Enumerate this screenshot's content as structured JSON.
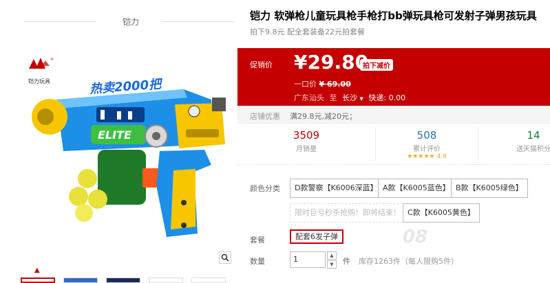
{
  "brand": {
    "name": "铠力",
    "logo_text": "铠力玩具"
  },
  "product": {
    "title": "铠力 软弹枪儿童玩具枪手枪打bb弹玩具枪可发射子弹男孩玩具",
    "subtitle": "拍下9.8元 配全套装备22元拍套餐",
    "image_text": "热卖2000把",
    "image_label": "ELITE"
  },
  "price": {
    "label": "促销价",
    "currency": "¥",
    "value": "29.80",
    "badge": "拍下减价",
    "original_label": "一口价",
    "original_value": "¥ 69.00"
  },
  "shipping": {
    "from": "广东汕头",
    "to_word": "至",
    "to": "长沙",
    "fee_label": "快递:",
    "fee": "0.00"
  },
  "promo": {
    "label": "店铺优惠",
    "text": "满29.8元,减20元；"
  },
  "stats": [
    {
      "value": "3509",
      "label": "月销量"
    },
    {
      "value": "508",
      "label": "累计评价",
      "stars": "★★★★★",
      "score": "4.9"
    },
    {
      "value": "14",
      "label": "送天猫积分"
    }
  ],
  "color": {
    "label": "颜色分类",
    "options": [
      "D款警察【K6006深蓝】",
      "A款【K6005蓝色】",
      "B款【K6005绿色】",
      "限时巨亏秒杀抢购！即将结束！",
      "C款【K6005黄色】"
    ]
  },
  "package": {
    "label": "套餐",
    "option": "配套6发子弹"
  },
  "quantity": {
    "label": "数量",
    "value": "1",
    "unit": "件",
    "stock": "库存1263件（每人限购5件）"
  },
  "watermark": "08"
}
